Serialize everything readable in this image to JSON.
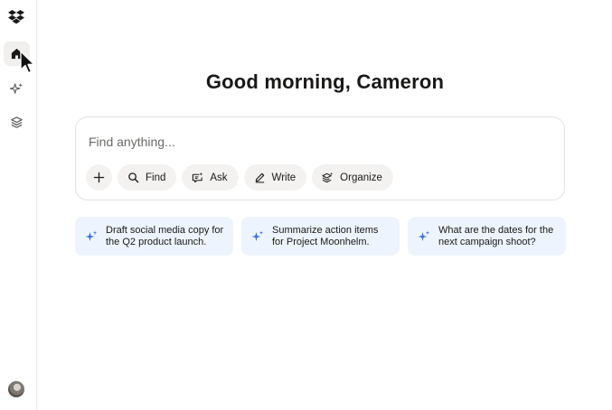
{
  "app": {
    "greeting": "Good morning, Cameron"
  },
  "rail": {
    "items": [
      {
        "icon": "home-icon",
        "active": true
      },
      {
        "icon": "sparkle-icon",
        "active": false
      },
      {
        "icon": "layers-icon",
        "active": false
      }
    ]
  },
  "composer": {
    "placeholder": "Find anything...",
    "actions": [
      {
        "label": "Find",
        "icon": "search-icon"
      },
      {
        "label": "Ask",
        "icon": "chat-sparkle-icon"
      },
      {
        "label": "Write",
        "icon": "pencil-icon"
      },
      {
        "label": "Organize",
        "icon": "layers-sparkle-icon"
      }
    ]
  },
  "suggestions": [
    {
      "line1": "Draft social media copy for",
      "line2": "the Q2 product launch."
    },
    {
      "line1": "Summarize action items",
      "line2": "for Project Moonhelm."
    },
    {
      "line1": "What are the dates for the",
      "line2": "next campaign shoot?"
    }
  ],
  "colors": {
    "accent": "#3b6fd8",
    "suggestion_bg": "#eef4fd",
    "chip_bg": "#f3f2f0"
  }
}
